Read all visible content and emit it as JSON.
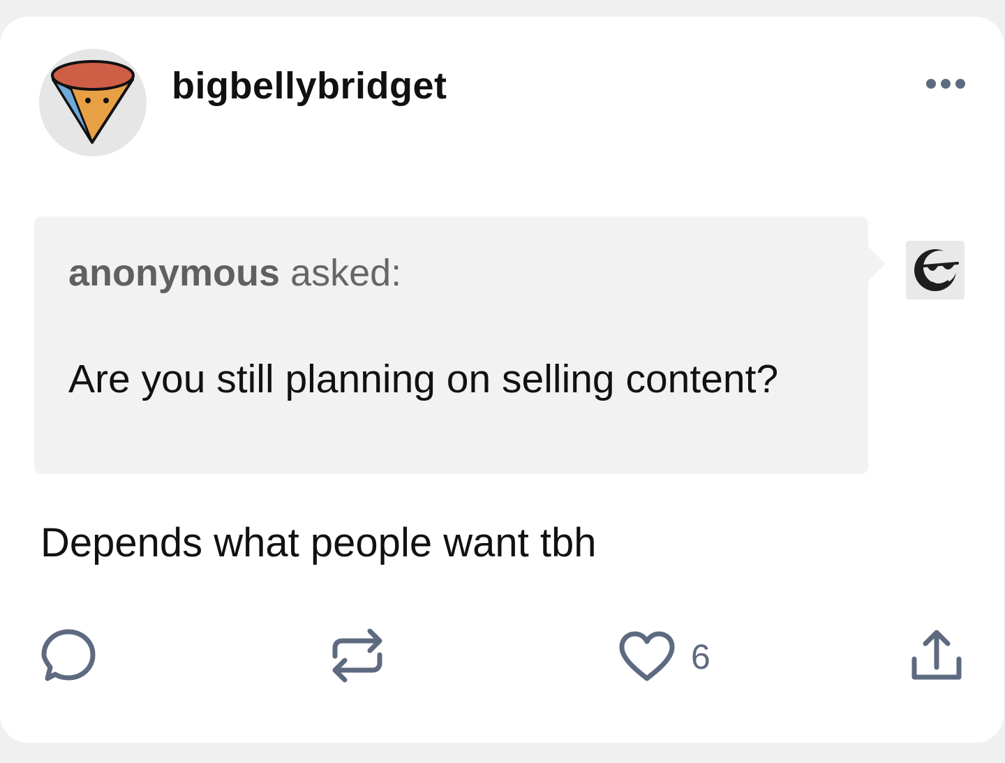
{
  "post": {
    "username": "bigbellybridget",
    "avatar_icon": "pizza-slice-avatar-icon",
    "more_icon": "ellipsis-icon",
    "ask": {
      "asker": "anonymous",
      "asked_suffix": " asked:",
      "question": "Are you still planning on selling content?",
      "asker_avatar_icon": "anonymous-sunglasses-avatar-icon"
    },
    "answer": "Depends what people want tbh",
    "actions": {
      "reply_icon": "reply-bubble-icon",
      "reblog_icon": "reblog-icon",
      "like_icon": "heart-icon",
      "like_count": "6",
      "share_icon": "share-icon"
    }
  },
  "colors": {
    "page_background": "#f0f0f0",
    "card_background": "#ffffff",
    "bubble_background": "#f2f2f2",
    "icon_color": "#5e6a80",
    "text_color": "#111111"
  }
}
